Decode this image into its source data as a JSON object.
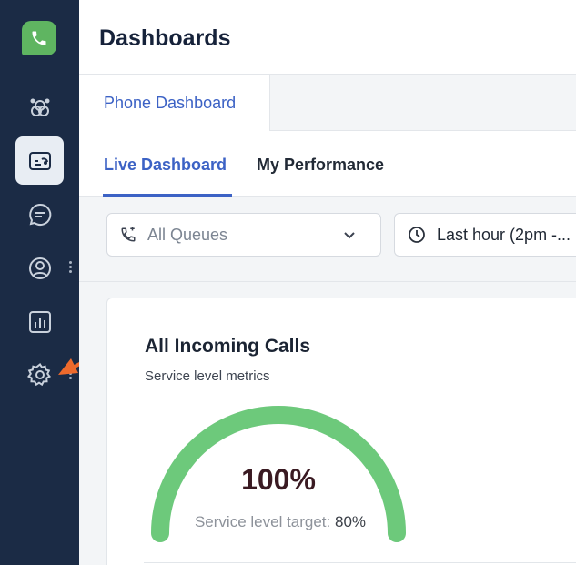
{
  "sidebar": {
    "logo_icon": "phone-icon",
    "items": [
      {
        "name": "workflows",
        "icon": "nodes-icon"
      },
      {
        "name": "dashboards",
        "icon": "dashboard-icon",
        "active": true
      },
      {
        "name": "messages",
        "icon": "chat-icon"
      },
      {
        "name": "contacts",
        "icon": "user-icon"
      },
      {
        "name": "reports",
        "icon": "bar-chart-icon"
      },
      {
        "name": "settings",
        "icon": "gear-icon"
      }
    ],
    "bg_color": "#1b2b45",
    "logo_color": "#5fb561"
  },
  "header": {
    "title": "Dashboards"
  },
  "tabs": [
    {
      "label": "Phone Dashboard"
    }
  ],
  "subtabs": [
    {
      "label": "Live Dashboard"
    },
    {
      "label": "My Performance"
    }
  ],
  "filters": {
    "queues": {
      "value": "All Queues"
    },
    "time": {
      "value": "Last hour (2pm -..."
    }
  },
  "card": {
    "title": "All Incoming Calls",
    "subtitle": "Service level metrics",
    "gauge": {
      "value": "100%",
      "fill_fraction": 1.0,
      "target_label": "Service level target:",
      "target_value": "80%",
      "color": "#6dc97b"
    }
  },
  "annotation": {
    "arrow_color": "#ee6a2c"
  },
  "accent_color": "#3c62c5"
}
